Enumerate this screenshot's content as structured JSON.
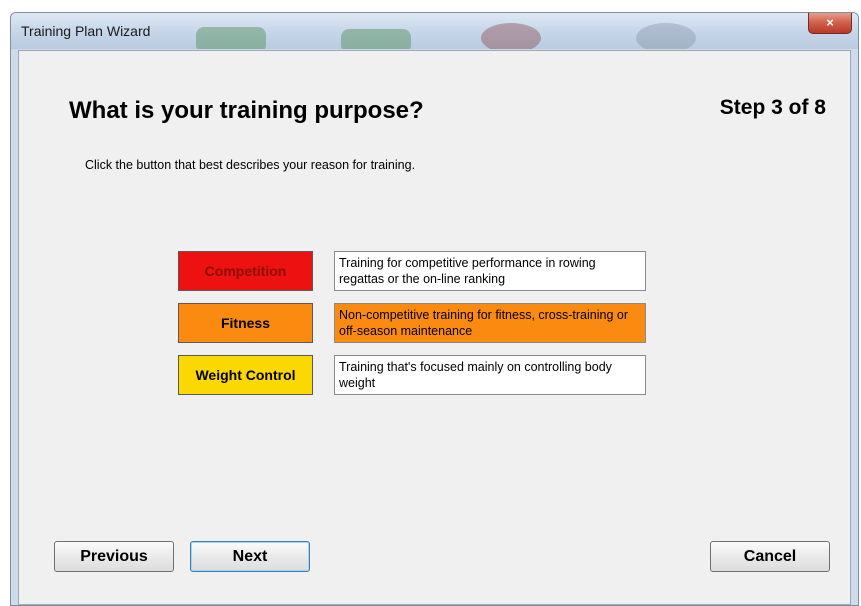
{
  "window": {
    "title": "Training Plan Wizard",
    "close_glyph": "×"
  },
  "page": {
    "heading": "What is your training purpose?",
    "step": "Step 3 of 8",
    "instruction": "Click the button that best describes your reason for training."
  },
  "options": [
    {
      "label": "Competition",
      "description": "Training for competitive performance in rowing regattas or the on-line ranking",
      "button_color": "#ee1111",
      "text_color": "#8a1000",
      "desc_bg": "#ffffff",
      "selected": false
    },
    {
      "label": "Fitness",
      "description": "Non-competitive training for fitness, cross-training or off-season maintenance",
      "button_color": "#fb8b10",
      "text_color": "#000000",
      "desc_bg": "#fb8b10",
      "selected": true
    },
    {
      "label": "Weight Control",
      "description": "Training that's focused mainly on controlling body weight",
      "button_color": "#fcd803",
      "text_color": "#000000",
      "desc_bg": "#ffffff",
      "selected": false
    }
  ],
  "buttons": {
    "previous": "Previous",
    "next": "Next",
    "cancel": "Cancel"
  }
}
